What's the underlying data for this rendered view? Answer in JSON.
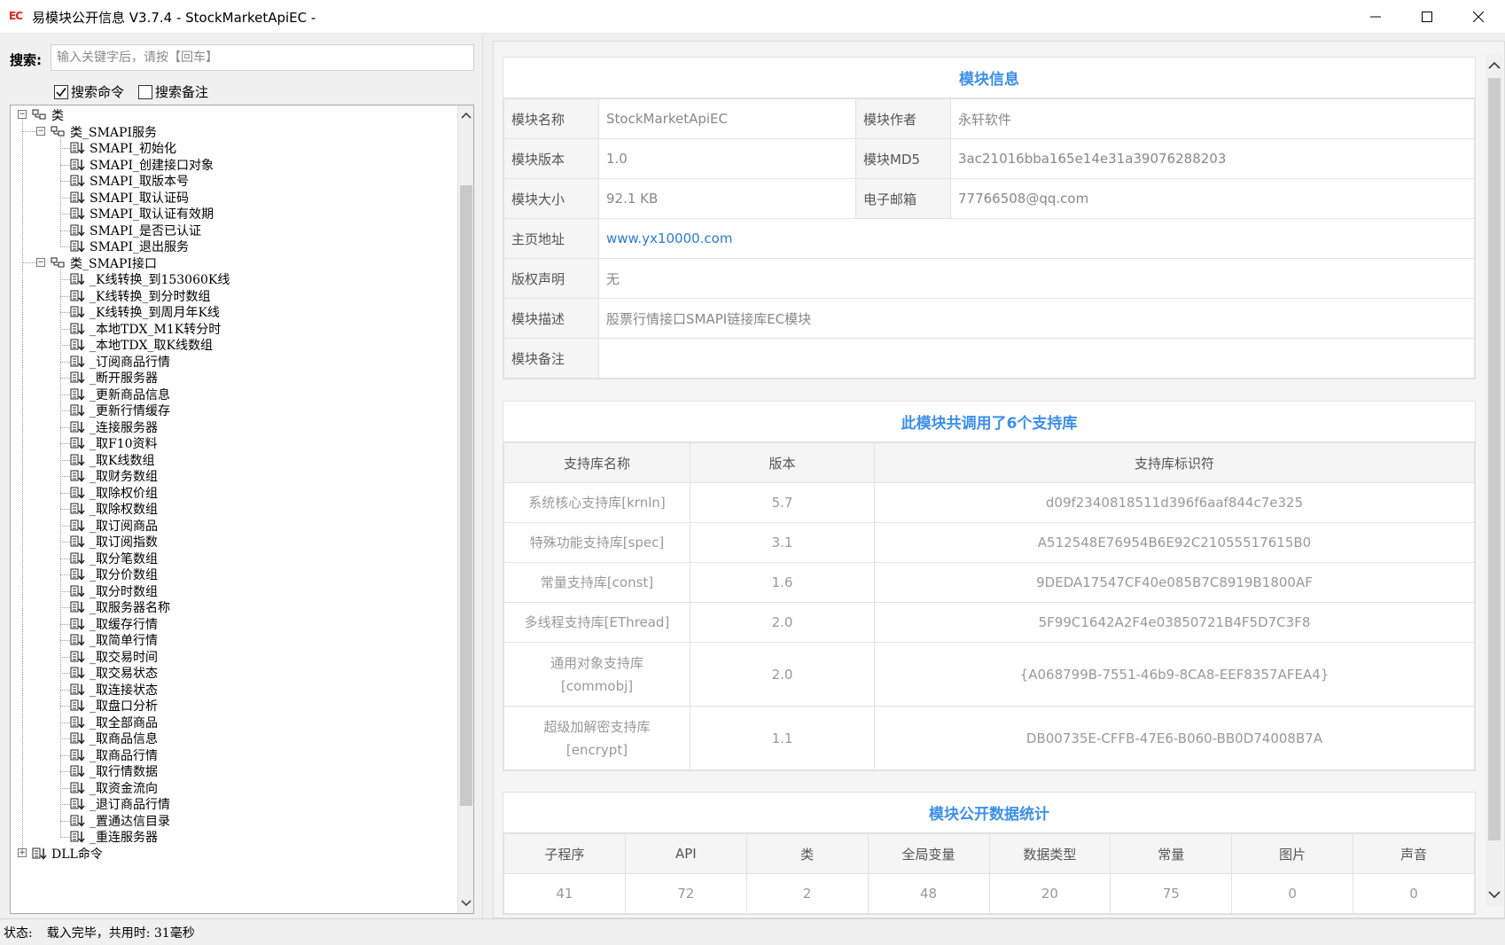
{
  "window": {
    "app_icon_text": "EC",
    "title": "易模块公开信息 V3.7.4 - StockMarketApiEC -"
  },
  "search": {
    "label": "搜索:",
    "placeholder": "输入关键字后，请按【回车】",
    "value": ""
  },
  "checkboxes": {
    "search_commands": {
      "label": "搜索命令",
      "checked": true
    },
    "search_notes": {
      "label": "搜索备注",
      "checked": false
    }
  },
  "tree": {
    "root": "类",
    "class1": "类_SMAPI服务",
    "class1_items": [
      "SMAPI_初始化",
      "SMAPI_创建接口对象",
      "SMAPI_取版本号",
      "SMAPI_取认证码",
      "SMAPI_取认证有效期",
      "SMAPI_是否已认证",
      "SMAPI_退出服务"
    ],
    "class2": "类_SMAPI接口",
    "class2_items": [
      "_K线转换_到153060K线",
      "_K线转换_到分时数组",
      "_K线转换_到周月年K线",
      "_本地TDX_M1K转分时",
      "_本地TDX_取K线数组",
      "_订阅商品行情",
      "_断开服务器",
      "_更新商品信息",
      "_更新行情缓存",
      "_连接服务器",
      "_取F10资料",
      "_取K线数组",
      "_取财务数组",
      "_取除权价组",
      "_取除权数组",
      "_取订阅商品",
      "_取订阅指数",
      "_取分笔数组",
      "_取分价数组",
      "_取分时数组",
      "_取服务器名称",
      "_取缓存行情",
      "_取简单行情",
      "_取交易时间",
      "_取交易状态",
      "_取连接状态",
      "_取盘口分析",
      "_取全部商品",
      "_取商品信息",
      "_取商品行情",
      "_取行情数据",
      "_取资金流向",
      "_退订商品行情",
      "_置通达信目录",
      "_重连服务器"
    ],
    "next_root": "DLL命令"
  },
  "module_info": {
    "title": "模块信息",
    "name_label": "模块名称",
    "name": "StockMarketApiEC",
    "author_label": "模块作者",
    "author": "永轩软件",
    "version_label": "模块版本",
    "version": "1.0",
    "md5_label": "模块MD5",
    "md5": "3ac21016bba165e14e31a39076288203",
    "size_label": "模块大小",
    "size": "92.1 KB",
    "email_label": "电子邮箱",
    "email": "77766508@qq.com",
    "homepage_label": "主页地址",
    "homepage": "www.yx10000.com",
    "copyright_label": "版权声明",
    "copyright": "无",
    "desc_label": "模块描述",
    "desc": "股票行情接口SMAPI链接库EC模块",
    "note_label": "模块备注",
    "note": ""
  },
  "libraries": {
    "title": "此模块共调用了6个支持库",
    "headers": [
      "支持库名称",
      "版本",
      "支持库标识符"
    ],
    "rows": [
      {
        "name": "系统核心支持库[krnln]",
        "version": "5.7",
        "id": "d09f2340818511d396f6aaf844c7e325"
      },
      {
        "name": "特殊功能支持库[spec]",
        "version": "3.1",
        "id": "A512548E76954B6E92C21055517615B0"
      },
      {
        "name": "常量支持库[const]",
        "version": "1.6",
        "id": "9DEDA17547CF40e085B7C8919B1800AF"
      },
      {
        "name": "多线程支持库[EThread]",
        "version": "2.0",
        "id": "5F99C1642A2F4e03850721B4F5D7C3F8"
      },
      {
        "name_line1": "通用对象支持库",
        "name_line2": "[commobj]",
        "version": "2.0",
        "id": "{A068799B-7551-46b9-8CA8-EEF8357AFEA4}"
      },
      {
        "name_line1": "超级加解密支持库",
        "name_line2": "[encrypt]",
        "version": "1.1",
        "id": "DB00735E-CFFB-47E6-B060-BB0D74008B7A"
      }
    ]
  },
  "stats": {
    "title": "模块公开数据统计",
    "headers": [
      "子程序",
      "API",
      "类",
      "全局变量",
      "数据类型",
      "常量",
      "图片",
      "声音"
    ],
    "values": [
      "41",
      "72",
      "2",
      "48",
      "20",
      "75",
      "0",
      "0"
    ]
  },
  "status": {
    "label": "状态:",
    "text": "载入完毕，共用时: 31毫秒"
  }
}
